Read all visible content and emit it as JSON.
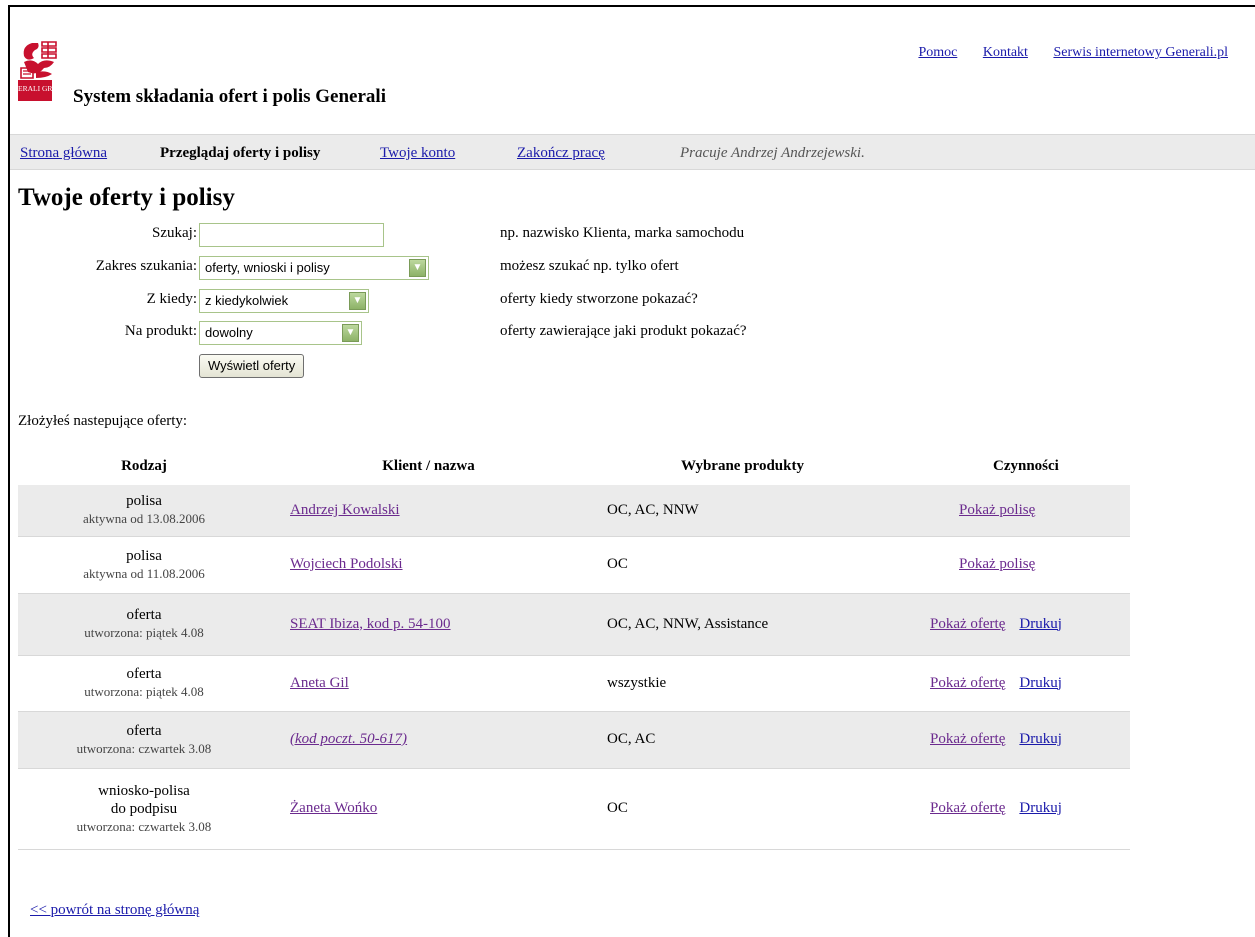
{
  "header": {
    "title": "System składania ofert i polis Generali",
    "logo_text": "GENERALI GROUP",
    "links": [
      "Pomoc",
      "Kontakt",
      "Serwis internetowy Generali.pl"
    ]
  },
  "nav": {
    "home": "Strona główna",
    "browse": "Przeglądaj oferty i polisy",
    "account": "Twoje konto",
    "logout": "Zakończ pracę",
    "user": "Pracuje Andrzej Andrzejewski."
  },
  "page_title": "Twoje oferty i polisy",
  "search": {
    "query_label": "Szukaj:",
    "query_value": "",
    "query_hint": "np. nazwisko Klienta, marka samochodu",
    "scope_label": "Zakres szukania:",
    "scope_value": "oferty, wnioski i polisy",
    "scope_hint": "możesz szukać np. tylko ofert",
    "when_label": "Z kiedy:",
    "when_value": "z kiedykolwiek",
    "when_hint": "oferty kiedy stworzone pokazać?",
    "product_label": "Na produkt:",
    "product_value": "dowolny",
    "product_hint": "oferty zawierające jaki produkt pokazać?",
    "submit": "Wyświetl oferty"
  },
  "intro": "Złożyłeś nastepujące oferty:",
  "table": {
    "headers": [
      "Rodzaj",
      "Klient / nazwa",
      "Wybrane produkty",
      "Czynności"
    ],
    "rows": [
      {
        "type": "polisa",
        "type2": "",
        "date": "aktywna od 13.08.2006",
        "client": "Andrzej Kowalski",
        "products": "OC, AC, NNW",
        "action1": "Pokaż polisę",
        "action2": ""
      },
      {
        "type": "polisa",
        "type2": "",
        "date": "aktywna od 11.08.2006",
        "client": "Wojciech Podolski",
        "products": "OC",
        "action1": "Pokaż polisę",
        "action2": ""
      },
      {
        "type": "oferta",
        "type2": "",
        "date": "utworzona: piątek 4.08",
        "client": "SEAT Ibiza, kod p. 54-100",
        "products": "OC, AC, NNW, Assistance",
        "action1": "Pokaż ofertę",
        "action2": "Drukuj"
      },
      {
        "type": "oferta",
        "type2": "",
        "date": "utworzona: piątek 4.08",
        "client": "Aneta Gil",
        "products": "wszystkie",
        "action1": "Pokaż ofertę",
        "action2": "Drukuj"
      },
      {
        "type": "oferta",
        "type2": "",
        "date": "utworzona: czwartek 3.08",
        "client": "(kod poczt. 50-617)",
        "products": "OC, AC",
        "action1": "Pokaż ofertę",
        "action2": "Drukuj"
      },
      {
        "type": "wniosko-polisa",
        "type2": "do podpisu",
        "date": "utworzona: czwartek 3.08",
        "client": "Żaneta Wońko",
        "products": "OC",
        "action1": "Pokaż ofertę",
        "action2": "Drukuj"
      }
    ]
  },
  "back_link": "<< powrót na stronę główną",
  "colors": {
    "brand_red": "#c8102e",
    "link": "#1a1aaa",
    "visited": "#6b2a8e",
    "bar": "#ebebeb",
    "field_border": "#a8c48a"
  }
}
